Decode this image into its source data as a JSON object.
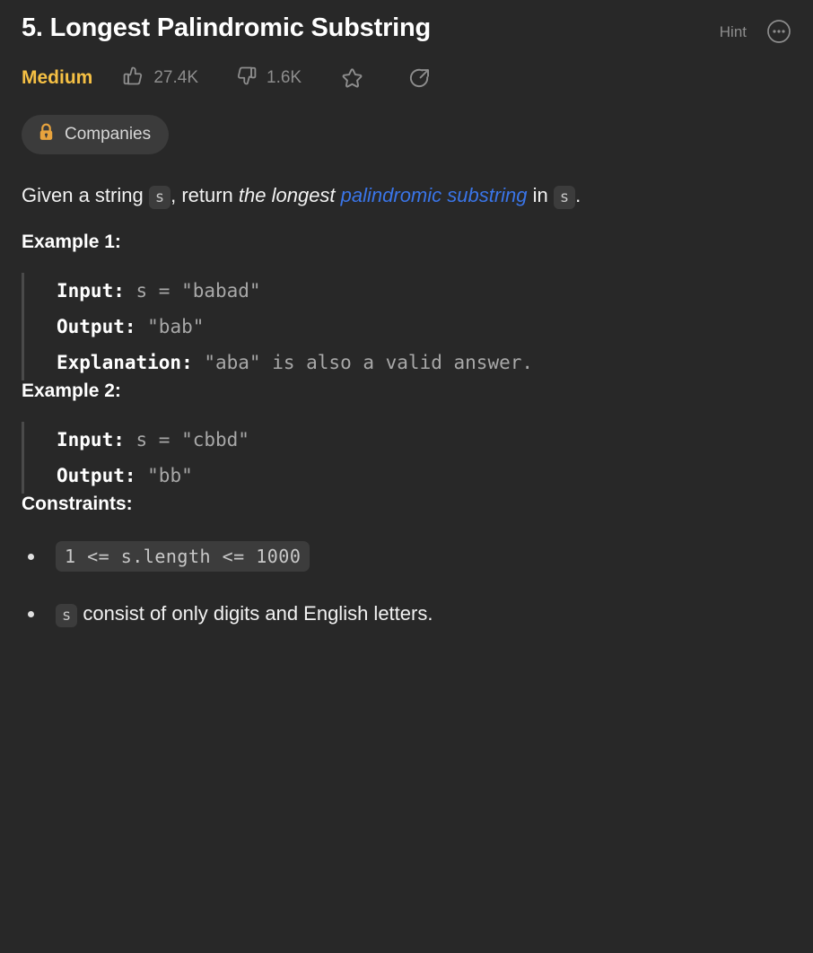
{
  "header": {
    "title": "5. Longest Palindromic Substring",
    "hint_label": "Hint",
    "more_icon": "more-horizontal-circle-icon"
  },
  "meta": {
    "difficulty": "Medium",
    "upvotes": "27.4K",
    "downvotes": "1.6K",
    "upvote_icon": "thumbs-up-icon",
    "downvote_icon": "thumbs-down-icon",
    "favorite_icon": "star-icon",
    "share_icon": "share-external-icon"
  },
  "tags": {
    "companies_label": "Companies",
    "companies_icon": "lock-icon"
  },
  "description": {
    "part1": "Given a string ",
    "code_s": "s",
    "part2": ", return ",
    "emphasis": "the longest ",
    "link_text": "palindromic substring",
    "part3": " in ",
    "code_s2": "s",
    "part4": "."
  },
  "examples": [
    {
      "heading": "Example 1:",
      "lines": [
        {
          "label": "Input:",
          "value": " s = \"babad\""
        },
        {
          "label": "Output:",
          "value": " \"bab\""
        },
        {
          "label": "Explanation:",
          "value": " \"aba\" is also a valid answer."
        }
      ]
    },
    {
      "heading": "Example 2:",
      "lines": [
        {
          "label": "Input:",
          "value": " s = \"cbbd\""
        },
        {
          "label": "Output:",
          "value": " \"bb\""
        }
      ]
    }
  ],
  "constraints": {
    "heading": "Constraints:",
    "items": [
      {
        "code": "1 <= s.length <= 1000",
        "text": ""
      },
      {
        "code": "s",
        "text": " consist of only digits and English letters."
      }
    ]
  },
  "colors": {
    "background": "#282828",
    "difficulty_medium": "#f5c044",
    "link_blue": "#3a75e8",
    "lock_orange": "#e8a33d",
    "pill_background": "#3b3b3b",
    "code_background": "#3c3c3c",
    "muted_text": "#8d8d8d"
  }
}
